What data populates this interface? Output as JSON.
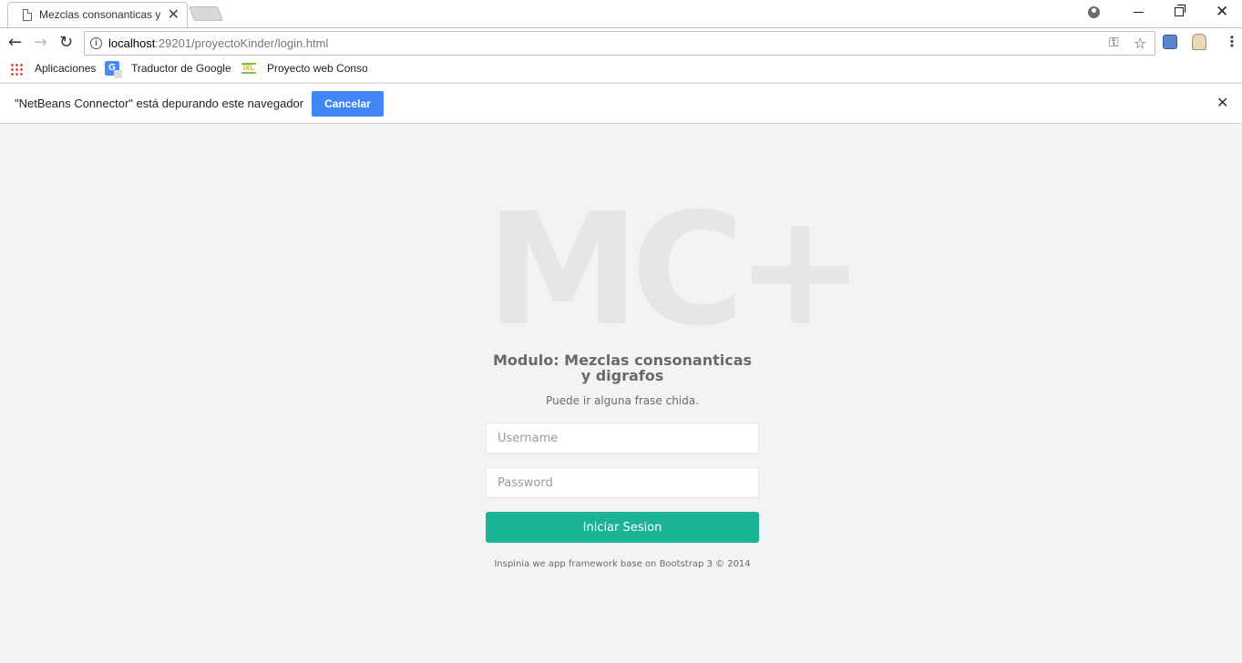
{
  "browser": {
    "tab": {
      "title": "Mezclas consonanticas y",
      "close_glyph": "✕"
    },
    "window_controls": {
      "minimize": "",
      "restore": "",
      "close": "✕"
    },
    "toolbar": {
      "back_glyph": "←",
      "forward_glyph": "→",
      "reload_glyph": "↻",
      "url_host": "localhost",
      "url_path": ":29201/proyectoKinder/login.html",
      "info_glyph": "i",
      "key_glyph": "⚿",
      "star_glyph": "☆",
      "menu_glyph": "⋮"
    },
    "bookmarks": [
      {
        "label": "Aplicaciones",
        "icon": "apps-grid-icon"
      },
      {
        "label": "Traductor de Google",
        "icon": "google-translate-icon"
      },
      {
        "label": "Proyecto web Conso",
        "icon": "ixl-icon"
      }
    ],
    "infobar": {
      "message": "\"NetBeans Connector\" está depurando este navegador",
      "cancel_label": "Cancelar",
      "close_glyph": "✕"
    }
  },
  "login": {
    "logo": "MC+",
    "heading": "Modulo: Mezclas consonanticas y digrafos",
    "subtitle": "Puede ir alguna frase chida.",
    "username_placeholder": "Username",
    "password_placeholder": "Password",
    "submit_label": "Iniciar Sesion",
    "footer": "Inspinia we app framework base on Bootstrap 3 © 2014"
  },
  "colors": {
    "page_bg": "#f3f3f4",
    "primary": "#1ab394",
    "infobar_button": "#4285f4",
    "logo": "#e6e6e6",
    "text": "#676a6c"
  }
}
